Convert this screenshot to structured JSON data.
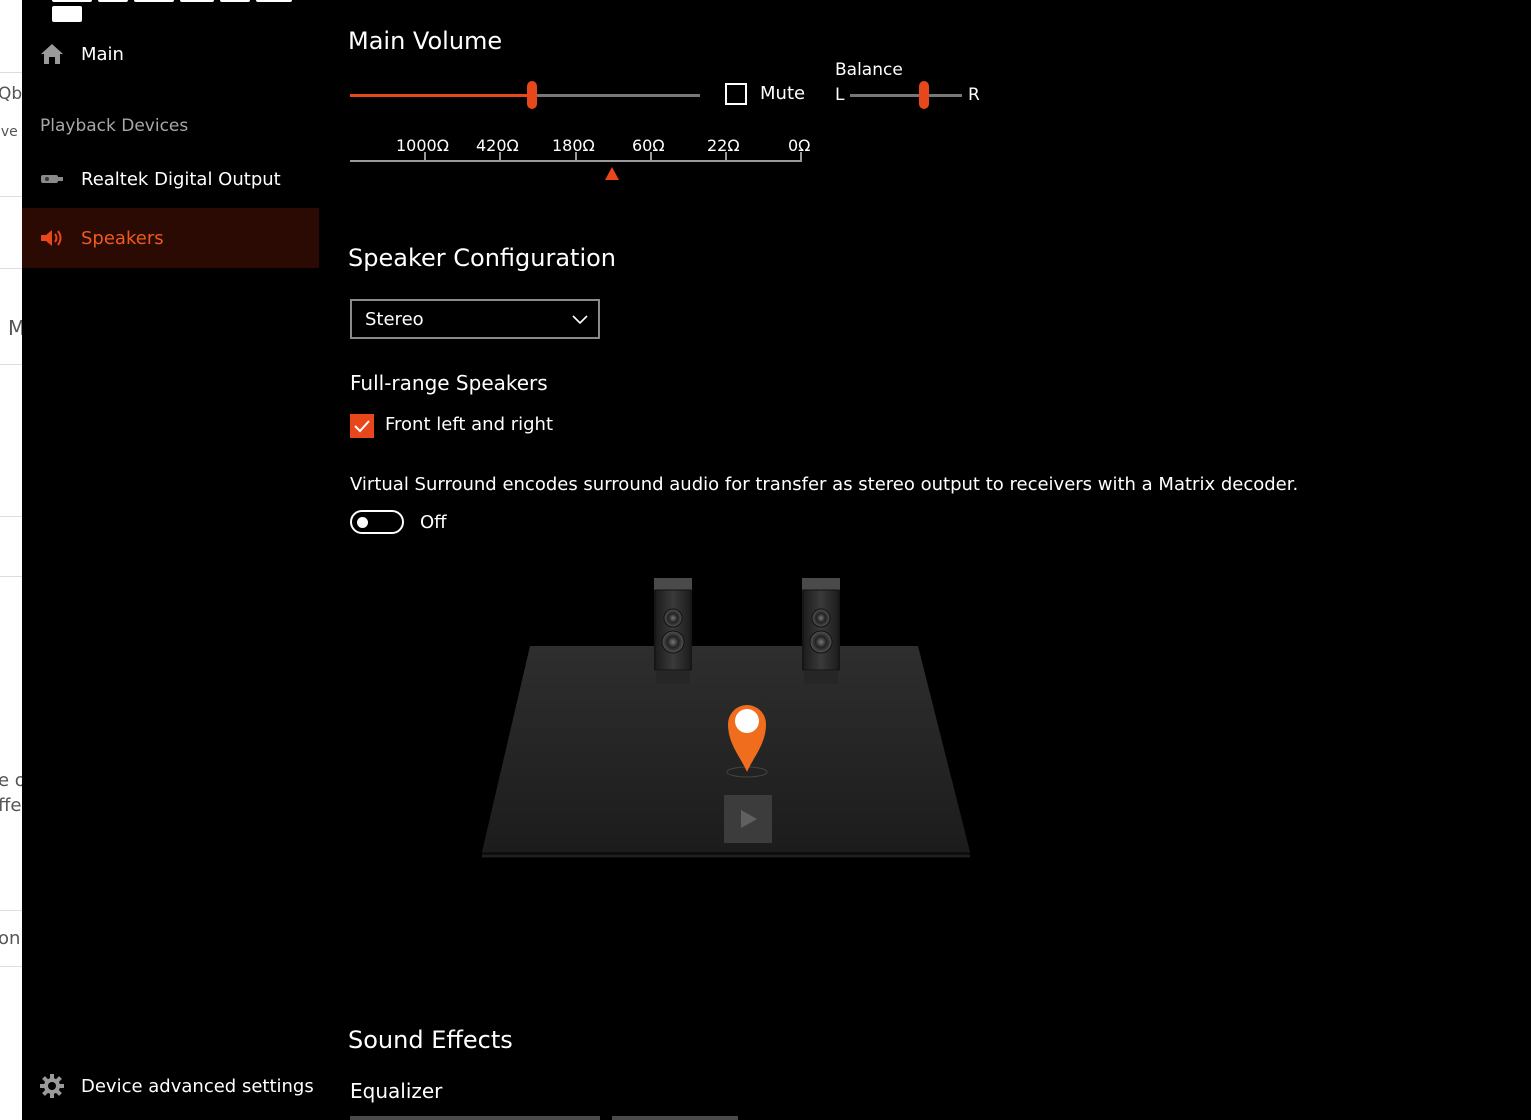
{
  "sidebar": {
    "main_label": "Main",
    "section_label": "Playback Devices",
    "items": [
      {
        "label": "Realtek Digital Output",
        "icon": "digital-output-icon",
        "active": false
      },
      {
        "label": "Speakers",
        "icon": "speaker-icon",
        "active": true
      }
    ],
    "footer_label": "Device advanced settings"
  },
  "volume": {
    "title": "Main Volume",
    "level": 0.52,
    "mute_label": "Mute",
    "mute_checked": false,
    "balance_label": "Balance",
    "balance_left": "L",
    "balance_right": "R",
    "balance_position": 0.66
  },
  "impedance": {
    "labels": [
      "1000Ω",
      "420Ω",
      "180Ω",
      "60Ω",
      "22Ω",
      "0Ω"
    ],
    "marker_position": 0.58
  },
  "speaker_config": {
    "title": "Speaker Configuration",
    "selected": "Stereo",
    "full_range_title": "Full-range Speakers",
    "front_lr_label": "Front left and right",
    "front_lr_checked": true,
    "surround_text": "Virtual Surround encodes surround audio for transfer as stereo output to receivers with a Matrix decoder.",
    "surround_state": "Off"
  },
  "sound_effects": {
    "title": "Sound Effects",
    "equalizer_label": "Equalizer"
  },
  "colors": {
    "accent": "#e8461b",
    "active_bg": "#2a0a02",
    "background": "#000000"
  }
}
